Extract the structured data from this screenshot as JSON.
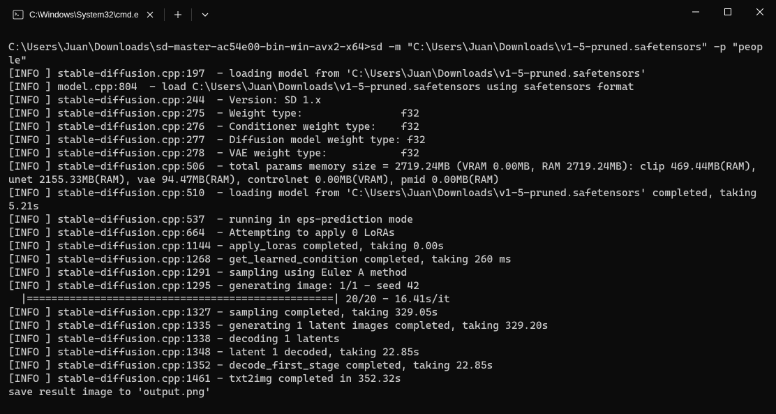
{
  "window": {
    "tab_title": "C:\\Windows\\System32\\cmd.e"
  },
  "terminal": {
    "lines": [
      "C:\\Users\\Juan\\Downloads\\sd-master-ac54e00-bin-win-avx2-x64>sd -m \"C:\\Users\\Juan\\Downloads\\v1-5-pruned.safetensors\" -p \"people\"",
      "[INFO ] stable-diffusion.cpp:197  - loading model from 'C:\\Users\\Juan\\Downloads\\v1-5-pruned.safetensors'",
      "[INFO ] model.cpp:804  - load C:\\Users\\Juan\\Downloads\\v1-5-pruned.safetensors using safetensors format",
      "[INFO ] stable-diffusion.cpp:244  - Version: SD 1.x",
      "[INFO ] stable-diffusion.cpp:275  - Weight type:                f32",
      "[INFO ] stable-diffusion.cpp:276  - Conditioner weight type:    f32",
      "[INFO ] stable-diffusion.cpp:277  - Diffusion model weight type: f32",
      "[INFO ] stable-diffusion.cpp:278  - VAE weight type:            f32",
      "[INFO ] stable-diffusion.cpp:506  - total params memory size = 2719.24MB (VRAM 0.00MB, RAM 2719.24MB): clip 469.44MB(RAM), unet 2155.33MB(RAM), vae 94.47MB(RAM), controlnet 0.00MB(VRAM), pmid 0.00MB(RAM)",
      "[INFO ] stable-diffusion.cpp:510  - loading model from 'C:\\Users\\Juan\\Downloads\\v1-5-pruned.safetensors' completed, taking 5.21s",
      "[INFO ] stable-diffusion.cpp:537  - running in eps-prediction mode",
      "[INFO ] stable-diffusion.cpp:664  - Attempting to apply 0 LoRAs",
      "[INFO ] stable-diffusion.cpp:1144 - apply_loras completed, taking 0.00s",
      "[INFO ] stable-diffusion.cpp:1268 - get_learned_condition completed, taking 260 ms",
      "[INFO ] stable-diffusion.cpp:1291 - sampling using Euler A method",
      "[INFO ] stable-diffusion.cpp:1295 - generating image: 1/1 - seed 42",
      "  |==================================================| 20/20 - 16.41s/it",
      "[INFO ] stable-diffusion.cpp:1327 - sampling completed, taking 329.05s",
      "[INFO ] stable-diffusion.cpp:1335 - generating 1 latent images completed, taking 329.20s",
      "[INFO ] stable-diffusion.cpp:1338 - decoding 1 latents",
      "[INFO ] stable-diffusion.cpp:1348 - latent 1 decoded, taking 22.85s",
      "[INFO ] stable-diffusion.cpp:1352 - decode_first_stage completed, taking 22.85s",
      "[INFO ] stable-diffusion.cpp:1461 - txt2img completed in 352.32s",
      "save result image to 'output.png'"
    ]
  }
}
